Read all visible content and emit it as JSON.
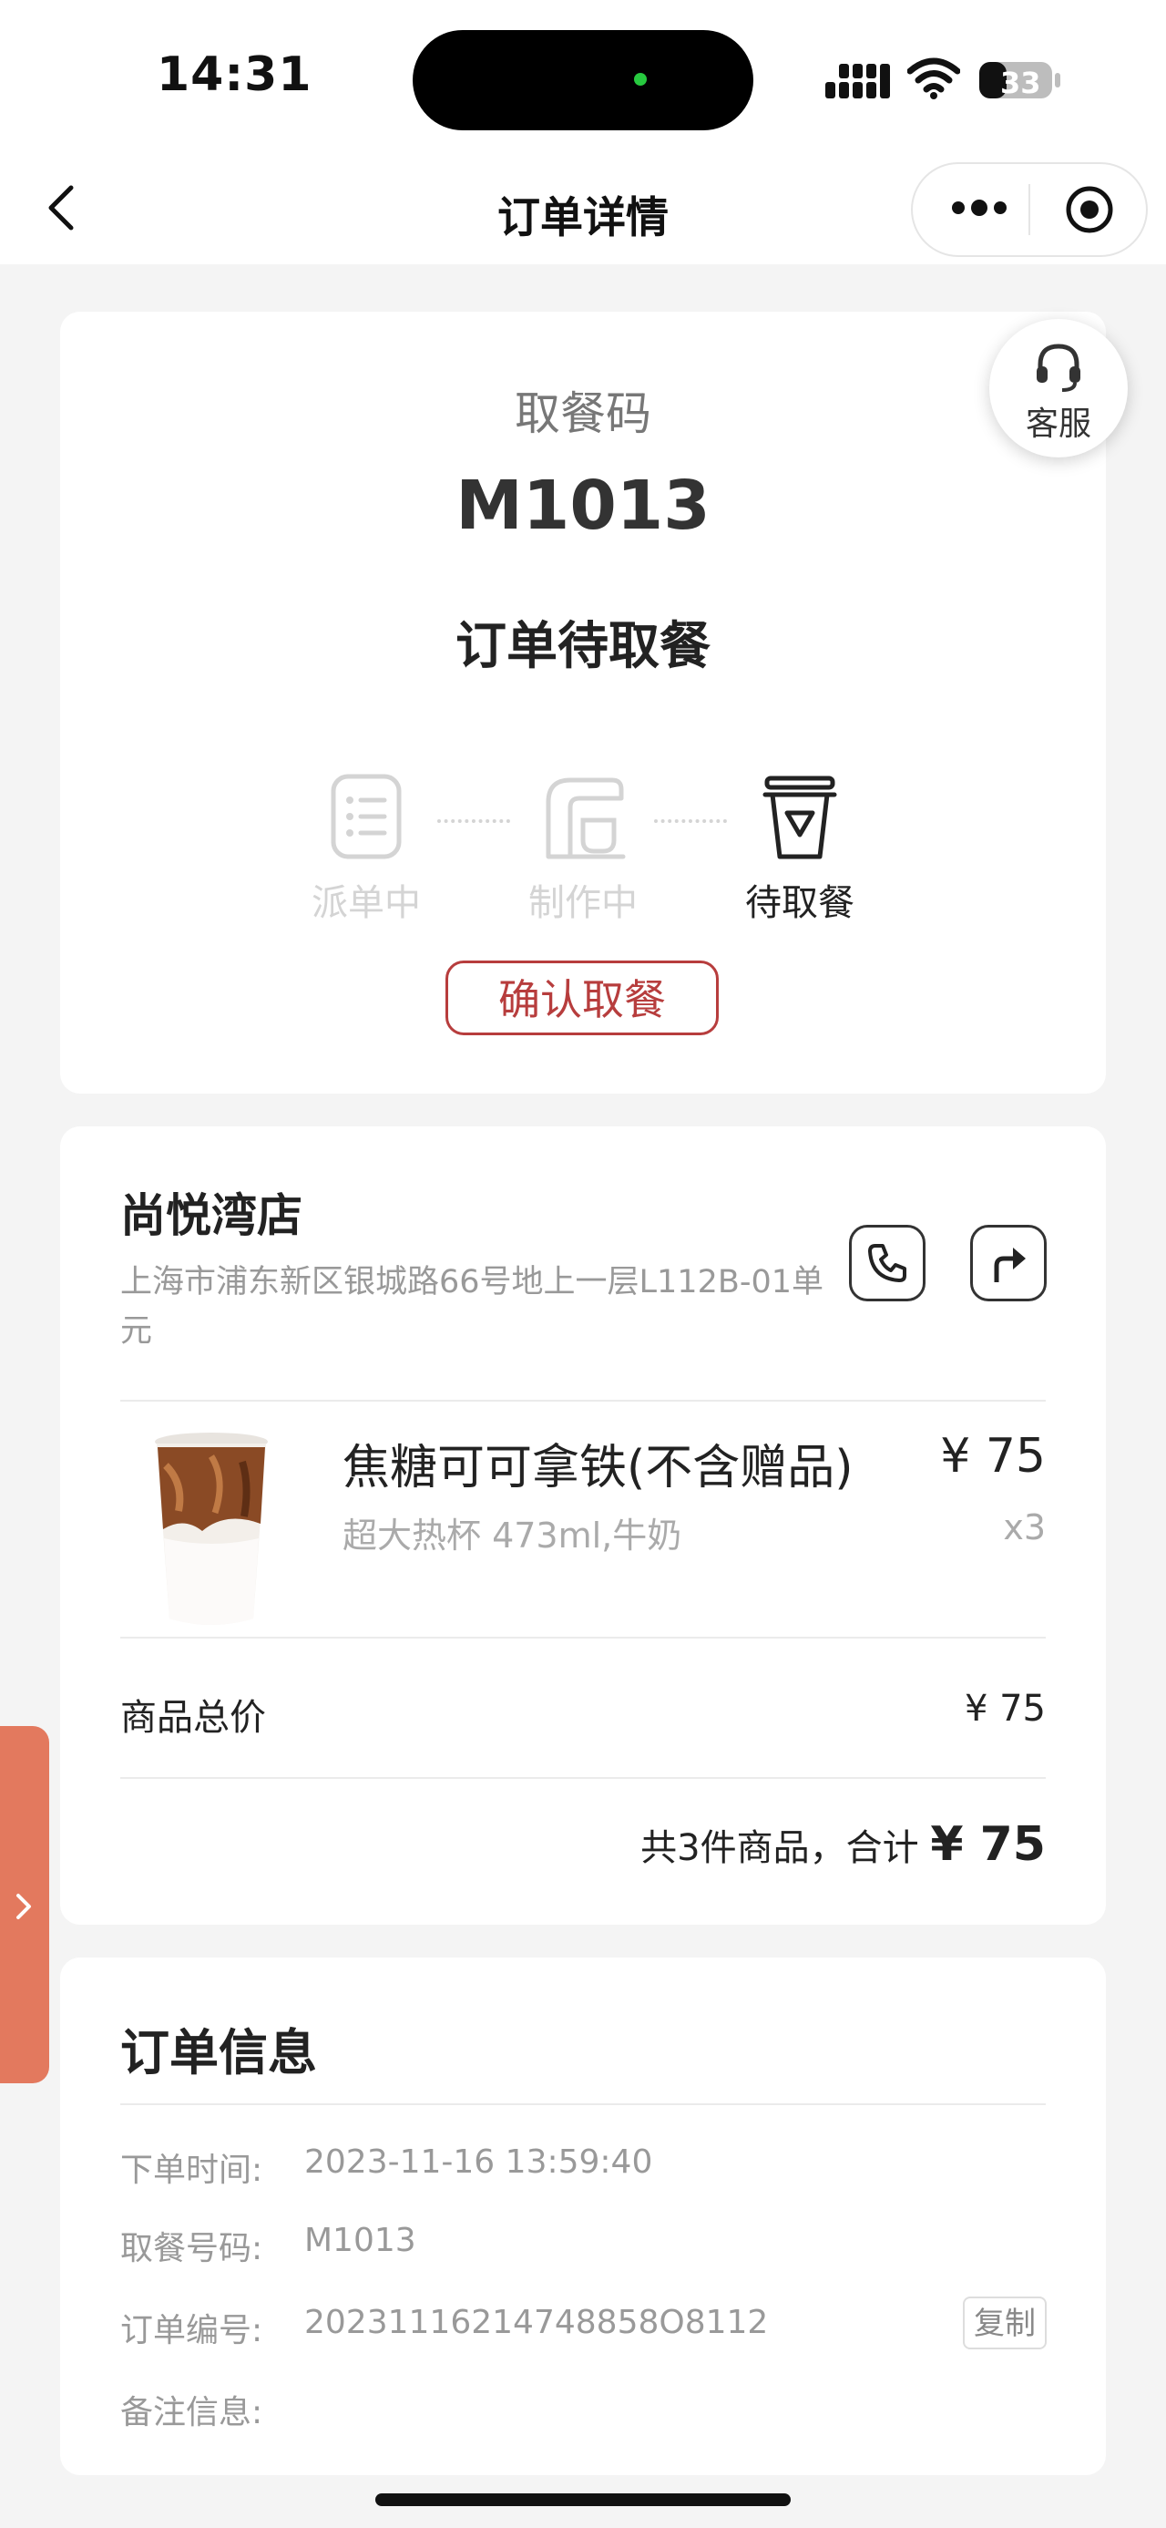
{
  "status_bar": {
    "time": "14:31",
    "battery": "33"
  },
  "nav": {
    "title": "订单详情"
  },
  "pickup": {
    "label": "取餐码",
    "code": "M1013",
    "status": "订单待取餐",
    "steps": [
      {
        "label": "派单中",
        "active": false
      },
      {
        "label": "制作中",
        "active": false
      },
      {
        "label": "待取餐",
        "active": true
      }
    ],
    "confirm_button": "确认取餐",
    "service_label": "客服"
  },
  "store": {
    "name": "尚悦湾店",
    "address": "上海市浦东新区银城路66号地上一层L112B-01单元"
  },
  "product": {
    "name": "焦糖可可拿铁(不含赠品)",
    "spec": "超大热杯 473ml,牛奶",
    "price": "¥ 75",
    "qty": "x3"
  },
  "summary": {
    "subtotal_label": "商品总价",
    "subtotal_value": "¥ 75",
    "total_prefix": "共3件商品，合计",
    "total_amount": "¥ 75"
  },
  "order_info": {
    "title": "订单信息",
    "rows": [
      {
        "label": "下单时间:",
        "value": "2023-11-16 13:59:40"
      },
      {
        "label": "取餐号码:",
        "value": "M1013"
      },
      {
        "label": "订单编号:",
        "value": "20231116214748858O8112"
      },
      {
        "label": "备注信息:",
        "value": ""
      }
    ],
    "copy_button": "复制"
  },
  "colors": {
    "accent_red": "#b73d3d",
    "side_tab": "#e3795e",
    "muted_text": "#999999",
    "inactive_step": "#d4d4d4"
  }
}
